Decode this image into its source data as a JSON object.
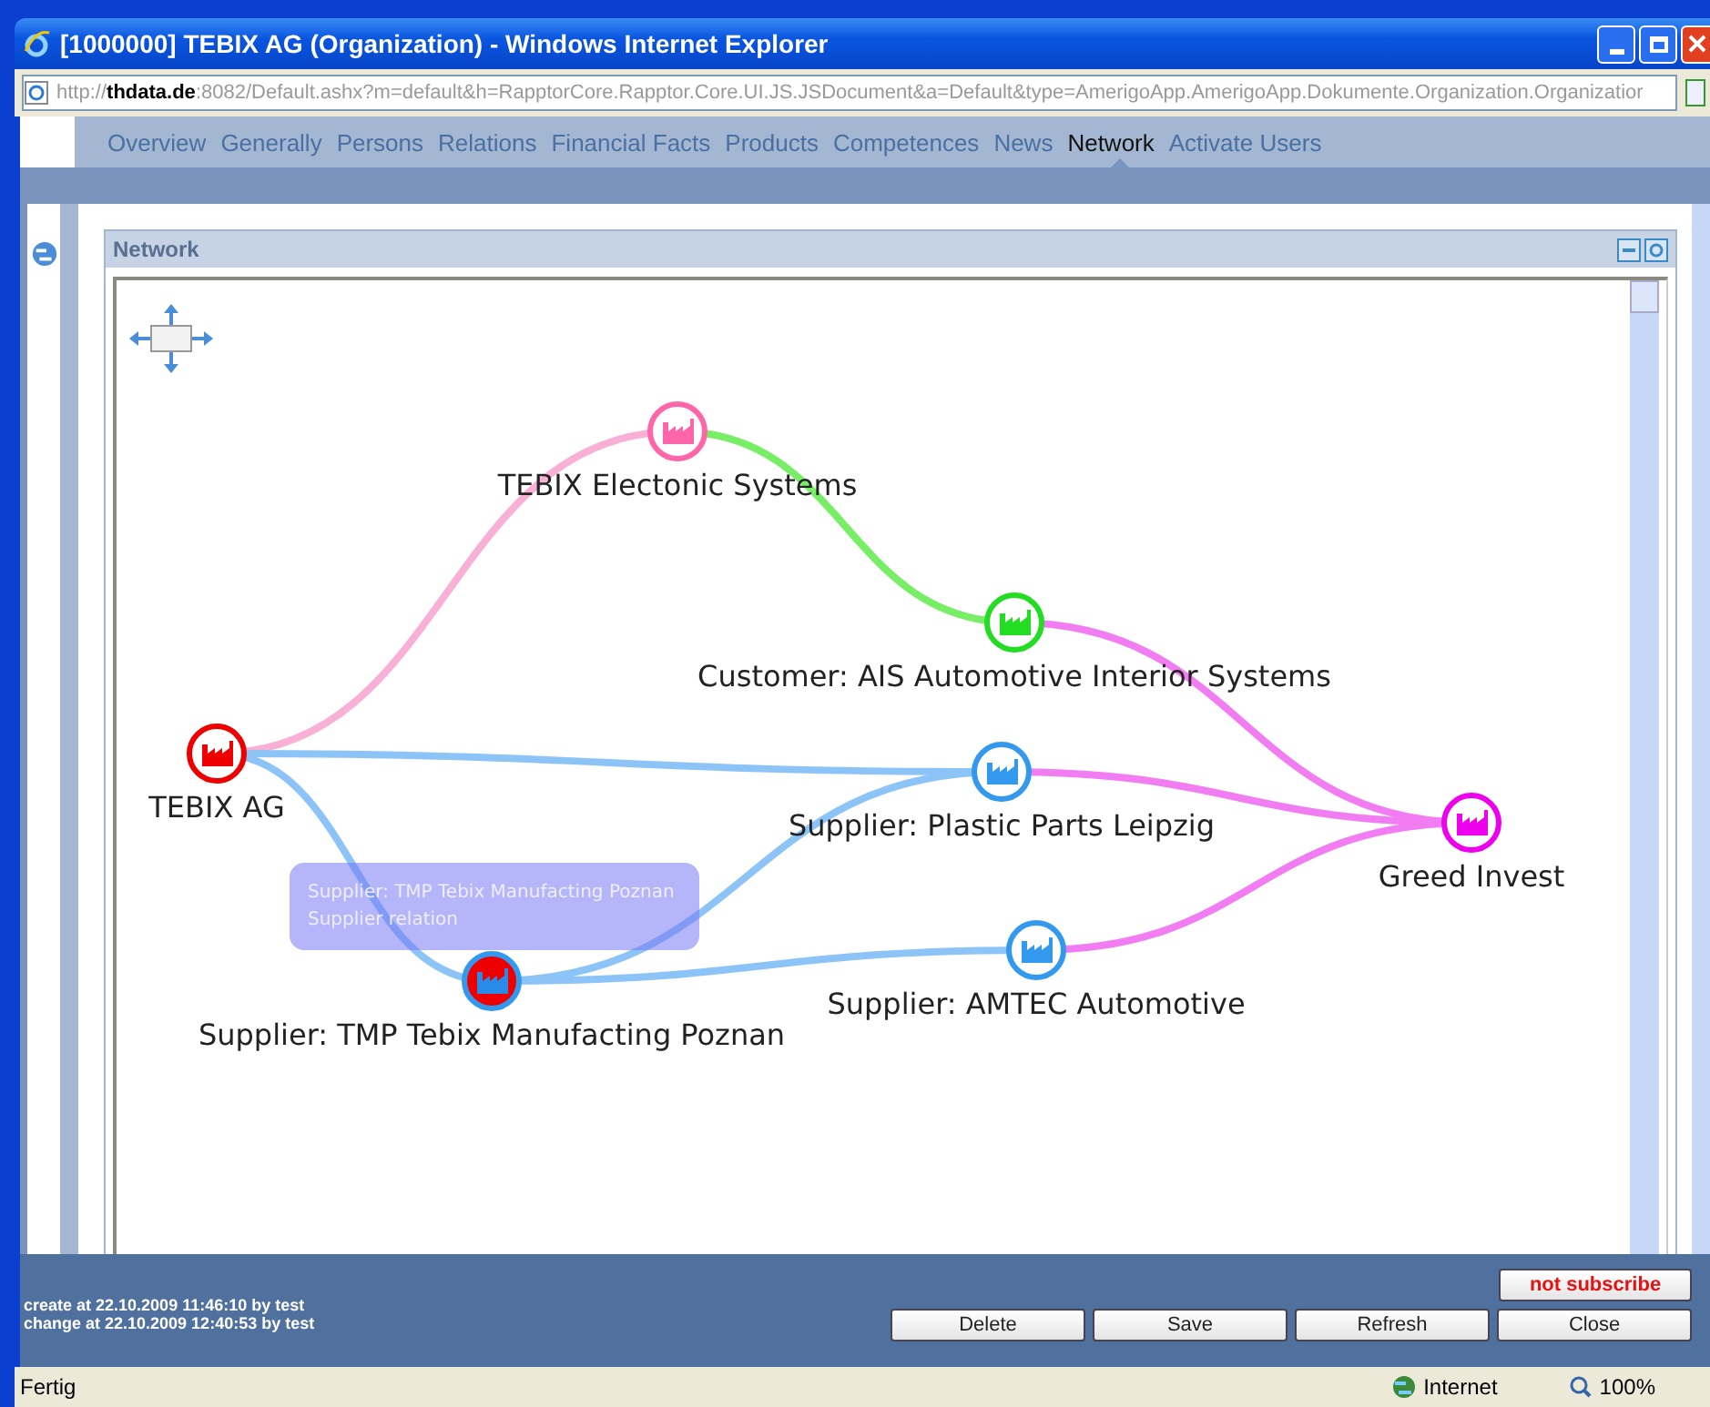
{
  "window": {
    "title": "[1000000] TEBIX AG (Organization) - Windows Internet Explorer"
  },
  "address": {
    "prefix": "http://",
    "host": "thdata.de",
    "rest": ":8082/Default.ashx?m=default&h=RapptorCore.Rapptor.Core.UI.JS.JSDocument&a=Default&type=AmerigoApp.AmerigoApp.Dokumente.Organization.Organizatior"
  },
  "tabs": [
    {
      "label": "Overview",
      "selected": false
    },
    {
      "label": "Generally",
      "selected": false
    },
    {
      "label": "Persons",
      "selected": false
    },
    {
      "label": "Relations",
      "selected": false
    },
    {
      "label": "Financial Facts",
      "selected": false
    },
    {
      "label": "Products",
      "selected": false
    },
    {
      "label": "Competences",
      "selected": false
    },
    {
      "label": "News",
      "selected": false
    },
    {
      "label": "Network",
      "selected": true
    },
    {
      "label": "Activate Users",
      "selected": false
    }
  ],
  "panel": {
    "title": "Network"
  },
  "nodes": [
    {
      "label": "TEBIX Electonic Systems",
      "color": "#ff66aa",
      "selected": false
    },
    {
      "label": "Customer: AIS Automotive Interior Systems",
      "color": "#22dd22",
      "selected": false
    },
    {
      "label": "TEBIX AG",
      "color": "#ee0000",
      "selected": false
    },
    {
      "label": "Supplier: Plastic Parts Leipzig",
      "color": "#3399ee",
      "selected": false
    },
    {
      "label": "Greed Invest",
      "color": "#ee00ee",
      "selected": false
    },
    {
      "label": "Supplier: AMTEC Automotive",
      "color": "#3399ee",
      "selected": false
    },
    {
      "label": "Supplier: TMP Tebix Manufacting Poznan",
      "color": "#3399ee",
      "selected": true
    }
  ],
  "edges": [
    {
      "color": "#f9b0d6"
    },
    {
      "color": "#77ee66"
    },
    {
      "color": "#f27cf2"
    },
    {
      "color": "#8cc4f7"
    },
    {
      "color": "#8cc4f7"
    },
    {
      "color": "#8cc4f7"
    },
    {
      "color": "#8cc4f7"
    },
    {
      "color": "#f27cf2"
    },
    {
      "color": "#f27cf2"
    }
  ],
  "tooltip": {
    "lines": [
      "Supplier: TMP Tebix Manufacting Poznan",
      "Supplier relation"
    ]
  },
  "audit": [
    "create at 22.10.2009 11:46:10 by test",
    "change at 22.10.2009 12:40:53 by test"
  ],
  "subscribe": "not subscribe",
  "buttons": [
    "Delete",
    "Save",
    "Refresh",
    "Close"
  ],
  "status": {
    "text": "Fertig",
    "zone": "Internet",
    "zoom": "100%"
  }
}
